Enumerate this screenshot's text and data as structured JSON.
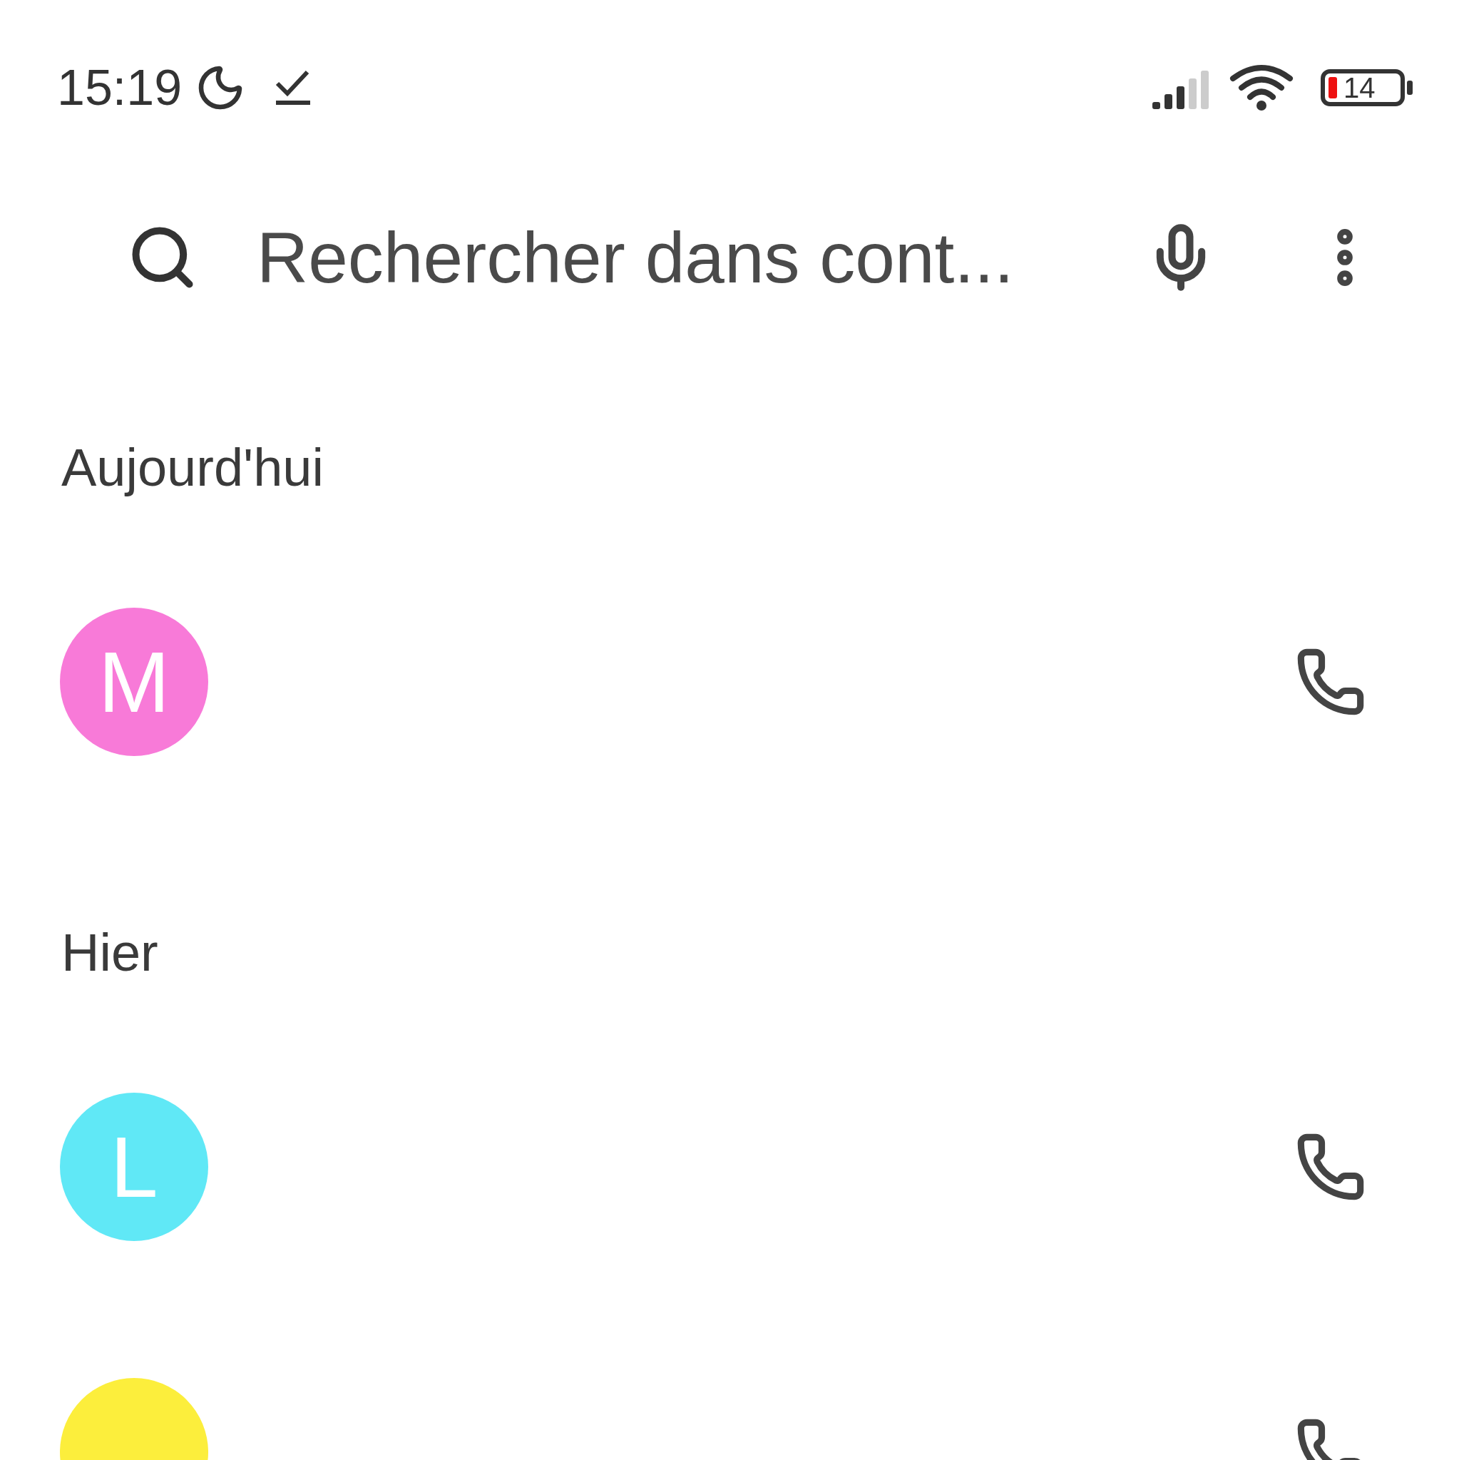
{
  "status_bar": {
    "time": "15:19",
    "battery": "14"
  },
  "search": {
    "placeholder": "Rechercher dans cont..."
  },
  "sections": [
    {
      "title": "Aujourd'hui",
      "calls": [
        {
          "initial": "M",
          "color": "#f87ad8"
        }
      ]
    },
    {
      "title": "Hier",
      "calls": [
        {
          "initial": "L",
          "color": "#60e8f6"
        },
        {
          "color": "#fcee3c"
        }
      ]
    }
  ]
}
